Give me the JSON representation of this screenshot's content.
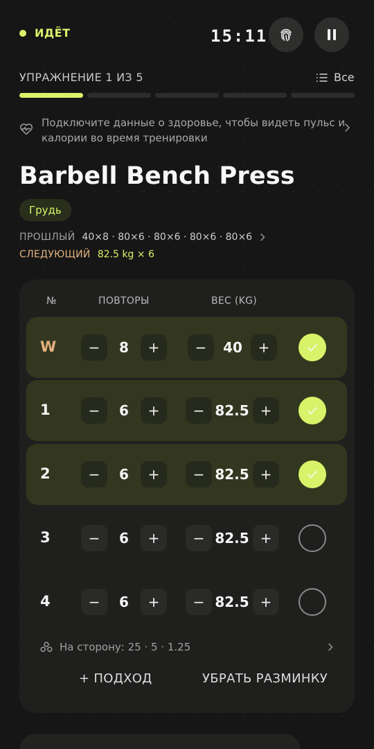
{
  "status": {
    "label": "ИДЁТ",
    "color": "#d8f36a"
  },
  "timer": "15:11",
  "exercise_progress": {
    "label": "УПРАЖНЕНИЕ 1 ИЗ 5",
    "current": 1,
    "total": 5,
    "all_label": "Все"
  },
  "health_banner": {
    "text": "Подключите данные о здоровье, чтобы видеть пульс и калории во время тренировки"
  },
  "exercise": {
    "name": "Barbell Bench Press",
    "tag": "Грудь",
    "previous_label": "ПРОШЛЫЙ",
    "previous_value": "40×8 · 80×6 · 80×6 · 80×6 · 80×6",
    "next_label": "СЛЕДУЮЩИЙ",
    "next_value": "82.5 kg × 6"
  },
  "sets_table": {
    "headers": {
      "num": "№",
      "reps": "ПОВТОРЫ",
      "weight": "ВЕС (KG)"
    },
    "rows": [
      {
        "num": "W",
        "reps": "8",
        "weight": "40",
        "done": true,
        "warmup": true
      },
      {
        "num": "1",
        "reps": "6",
        "weight": "82.5",
        "done": true,
        "warmup": false
      },
      {
        "num": "2",
        "reps": "6",
        "weight": "82.5",
        "done": true,
        "warmup": false
      },
      {
        "num": "3",
        "reps": "6",
        "weight": "82.5",
        "done": false,
        "warmup": false
      },
      {
        "num": "4",
        "reps": "6",
        "weight": "82.5",
        "done": false,
        "warmup": false
      }
    ],
    "minus": "−",
    "plus": "+",
    "plates_text": "На сторону: 25 · 5 · 1.25",
    "add_set_label": "+ ПОДХОД",
    "remove_warmup_label": "УБРАТЬ РАЗМИНКУ"
  },
  "colors": {
    "accent": "#d8f36a",
    "warmup": "#e3b27f",
    "done_row": "#34371f",
    "background": "#161616",
    "card": "#1f201e"
  }
}
